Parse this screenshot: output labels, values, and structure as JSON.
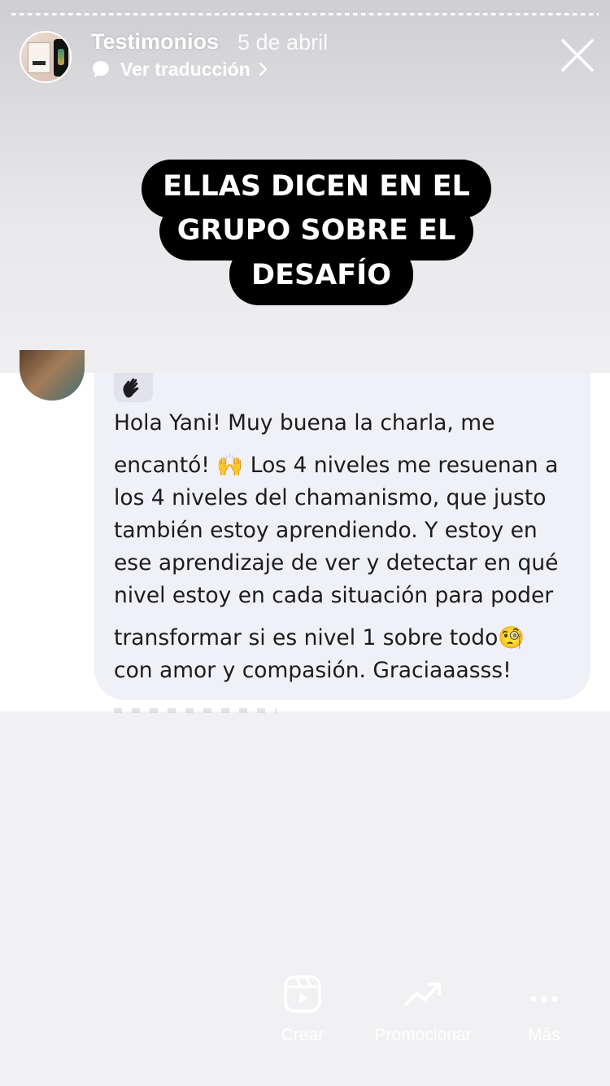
{
  "header": {
    "name": "Testimonios",
    "date": "5 de abril",
    "translate_label": "Ver traducción"
  },
  "headline": {
    "line1": "ELLAS DICEN EN EL",
    "line2": "GRUPO SOBRE EL",
    "line3": "DESAFÍO"
  },
  "comment": {
    "lines": [
      "Hola Yani! Muy buena la charla, me",
      "encantó! 🙌 Los 4 niveles me resuenan a",
      "los 4 niveles del chamanismo, que justo",
      "también estoy aprendiendo. Y estoy en",
      "ese aprendizaje de ver y detectar en qué",
      "nivel estoy en cada situación para poder",
      "transformar si es nivel 1 sobre todo🧐",
      "con amor y compasión. Graciaaasss!"
    ]
  },
  "toolbar": {
    "crear": "Crear",
    "promocionar": "Promocionar",
    "mas": "Más"
  },
  "colors": {
    "headline_bg": "#000000",
    "headline_text": "#ffffff",
    "bubble_bg": "#f0f1f6"
  },
  "icons": {
    "close": "close-icon",
    "translate": "speech-bubble-icon",
    "crear": "reels-icon",
    "promocionar": "trend-up-icon",
    "mas": "more-dots-icon",
    "wave": "waving-hand-icon"
  }
}
